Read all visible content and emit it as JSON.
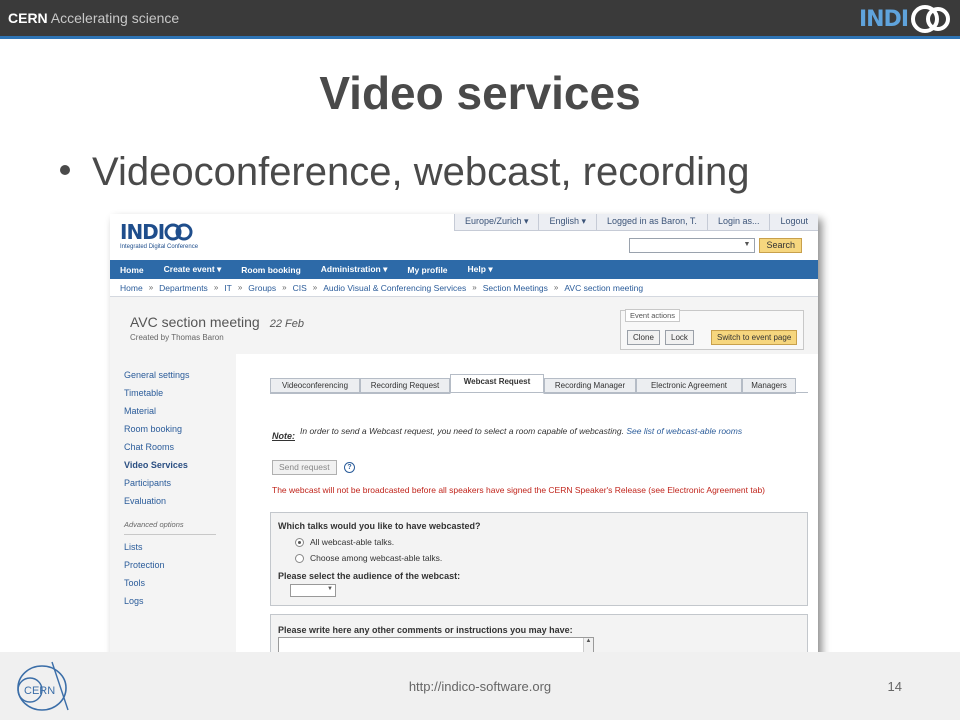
{
  "header": {
    "brand_bold": "CERN",
    "brand_rest": "Accelerating science",
    "logo_text_left": "INDI",
    "logo_text_right": "CO"
  },
  "slide": {
    "title": "Video services",
    "bullet": "Videoconference, webcast, recording"
  },
  "indico": {
    "logo_word": "INDI",
    "logo_co": "CO",
    "logo_sub": "Integrated Digital Conference",
    "user_bar": [
      "Europe/Zurich ▾",
      "English ▾",
      "Logged in as Baron, T.",
      "Login as...",
      "Logout"
    ],
    "search_button": "Search",
    "mainnav": [
      "Home",
      "Create event ▾",
      "Room booking",
      "Administration ▾",
      "My profile",
      "Help ▾"
    ],
    "breadcrumbs": [
      "Home",
      "Departments",
      "IT",
      "Groups",
      "CIS",
      "Audio Visual & Conferencing Services",
      "Section Meetings",
      "AVC section meeting"
    ],
    "event": {
      "title": "AVC section meeting",
      "date": "22 Feb",
      "creator": "Created by Thomas Baron",
      "actions_label": "Event actions",
      "clone": "Clone",
      "lock": "Lock",
      "switch": "Switch to event page"
    },
    "sidemenu": {
      "items": [
        "General settings",
        "Timetable",
        "Material",
        "Room booking",
        "Chat Rooms",
        "Video Services",
        "Participants",
        "Evaluation"
      ],
      "advanced_label": "Advanced options",
      "advanced_items": [
        "Lists",
        "Protection",
        "Tools",
        "Logs"
      ]
    },
    "tabs": [
      "Videoconferencing",
      "Recording Request",
      "Webcast Request",
      "Recording Manager",
      "Electronic Agreement",
      "Managers"
    ],
    "note_label": "Note:",
    "note_text": "In order to send a Webcast request, you need to select a room capable of webcasting.",
    "note_link": "See list of webcast-able rooms",
    "send_request": "Send request",
    "warning": "The webcast will not be broadcasted before all speakers have signed the CERN Speaker's Release (see Electronic Agreement tab)",
    "q1": "Which talks would you like to have webcasted?",
    "opt_all": "All webcast-able talks.",
    "opt_choose": "Choose among webcast-able talks.",
    "q2": "Please select the audience of the webcast:",
    "q3": "Please write here any other comments or instructions you may have:"
  },
  "footer": {
    "url": "http://indico-software.org",
    "page": "14",
    "logo": "CERN"
  },
  "colors": {
    "topbar": "#3a3a3a",
    "accent": "#2e74b5",
    "nav": "#2d6aa8",
    "link": "#2b5c9a",
    "warning": "#c0241b"
  }
}
